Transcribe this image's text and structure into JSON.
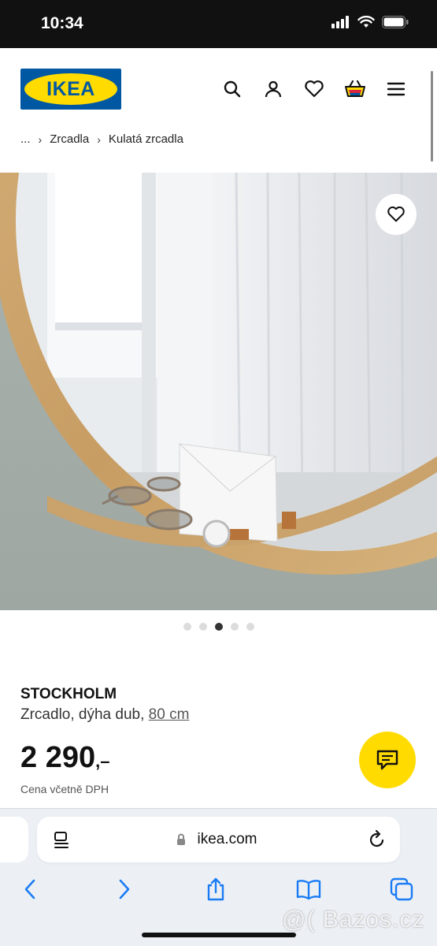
{
  "status_bar": {
    "time": "10:34"
  },
  "header": {
    "logo_text": "IKEA",
    "icons": [
      "search-icon",
      "user-icon",
      "heart-icon",
      "shopping-bag-icon",
      "menu-icon"
    ]
  },
  "breadcrumb": {
    "ellipsis": "...",
    "items": [
      "Zrcadla",
      "Kulatá zrcadla"
    ],
    "separator": "›"
  },
  "gallery": {
    "total_images": 5,
    "active_index": 2
  },
  "product": {
    "name": "STOCKHOLM",
    "description": "Zrcadlo, dýha dub,",
    "size": "80 cm",
    "price": "2 290",
    "price_suffix": ",–",
    "price_note": "Cena včetně DPH"
  },
  "browser": {
    "url": "ikea.com",
    "toolbar_icons": [
      "back-icon",
      "forward-icon",
      "share-icon",
      "bookmarks-icon",
      "tabs-icon"
    ]
  },
  "watermark": "@( Bazos.cz",
  "colors": {
    "ikea_blue": "#0058a3",
    "ikea_yellow": "#ffdb00",
    "safari_blue": "#1a7cf5",
    "status_bar": "#111111"
  }
}
